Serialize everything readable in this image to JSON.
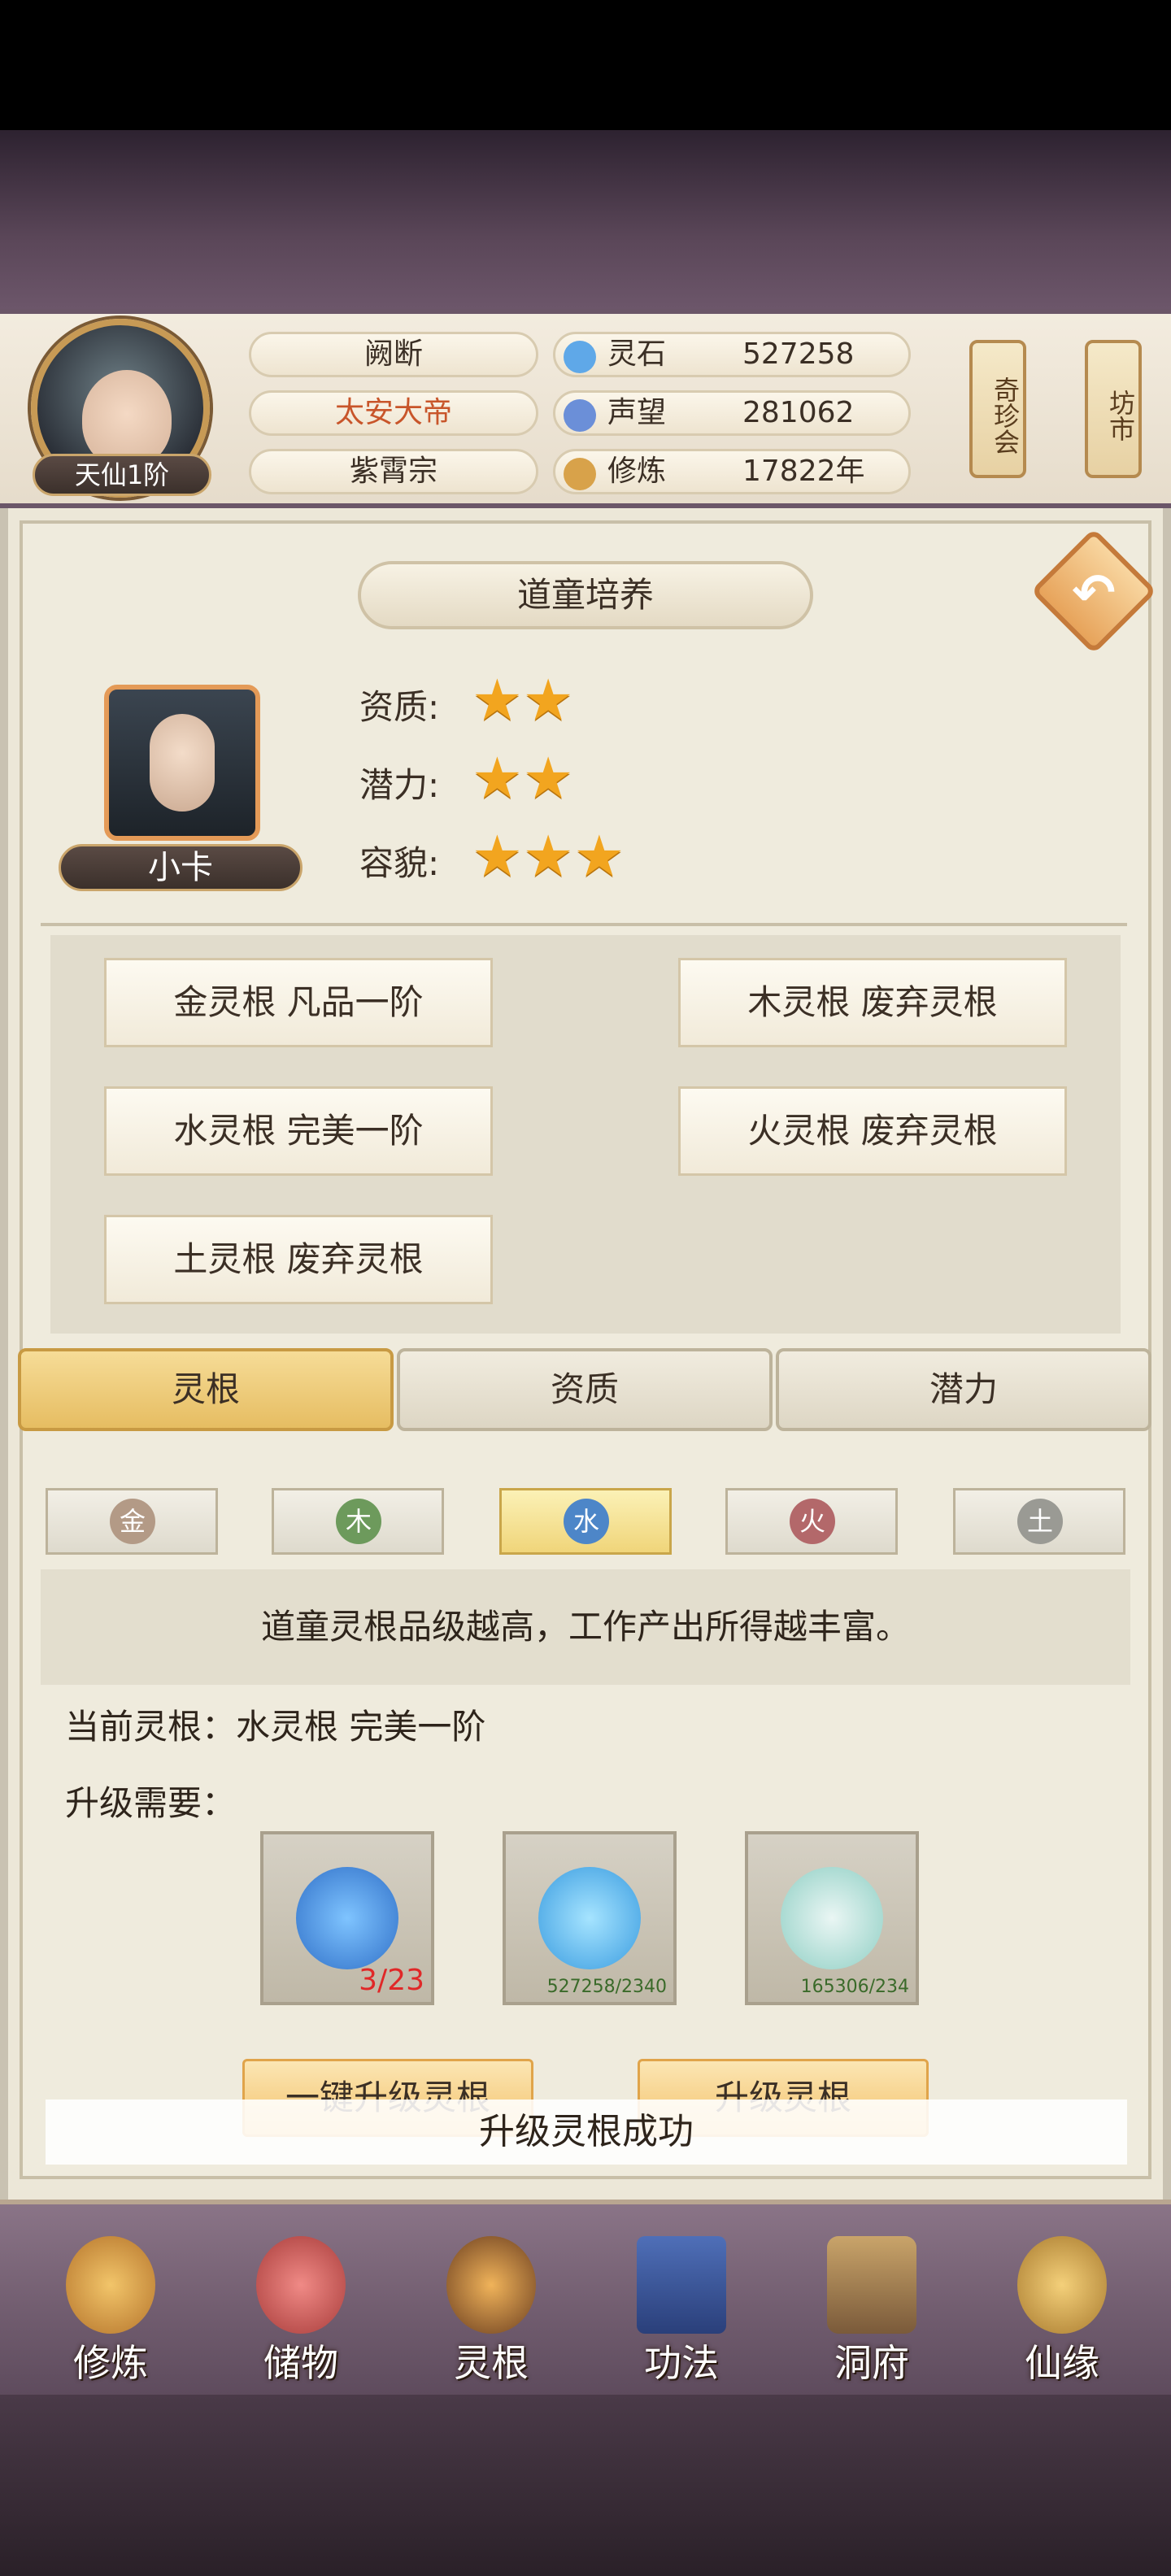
{
  "header": {
    "realm": "天仙1阶",
    "name": "阙断",
    "title": "太安大帝",
    "sect": "紫霄宗",
    "resources": [
      {
        "label": "灵石",
        "value": "527258",
        "icon": "spirit-stone-icon",
        "color": "#5fa8e8"
      },
      {
        "label": "声望",
        "value": "281062",
        "icon": "prestige-icon",
        "color": "#6b8fd8"
      },
      {
        "label": "修炼",
        "value": "17822年",
        "icon": "meditation-icon",
        "color": "#d8a24a"
      }
    ],
    "side_buttons": [
      "奇珍会",
      "坊市"
    ]
  },
  "panel": {
    "title": "道童培养",
    "character_name": "小卡",
    "attributes": [
      {
        "label": "资质:",
        "stars": 2
      },
      {
        "label": "潜力:",
        "stars": 2
      },
      {
        "label": "容貌:",
        "stars": 3
      }
    ],
    "roots": [
      "金灵根 凡品一阶",
      "木灵根 废弃灵根",
      "水灵根 完美一阶",
      "火灵根 废弃灵根",
      "土灵根 废弃灵根"
    ]
  },
  "tabs": {
    "root": "灵根",
    "aptitude": "资质",
    "potential": "潜力"
  },
  "elements": [
    {
      "label": "金",
      "color": "#b39a86"
    },
    {
      "label": "木",
      "color": "#6d9a5c"
    },
    {
      "label": "水",
      "color": "#4d86c8"
    },
    {
      "label": "火",
      "color": "#b3686a"
    },
    {
      "label": "土",
      "color": "#9a9a94"
    }
  ],
  "info": "道童灵根品级越高，工作产出所得越丰富。",
  "current_root": "当前灵根：水灵根 完美一阶",
  "upgrade_need": "升级需要：",
  "materials": [
    {
      "count": "3/23",
      "icon": "water-spirit-icon"
    },
    {
      "count": "527258/2340",
      "icon": "spirit-stone-icon"
    },
    {
      "count": "165306/234",
      "icon": "gourd-icon"
    }
  ],
  "actions": {
    "one_click": "一键升级灵根",
    "upgrade": "升级灵根"
  },
  "toast": "升级灵根成功",
  "nav": [
    "修炼",
    "储物",
    "灵根",
    "功法",
    "洞府",
    "仙缘"
  ]
}
